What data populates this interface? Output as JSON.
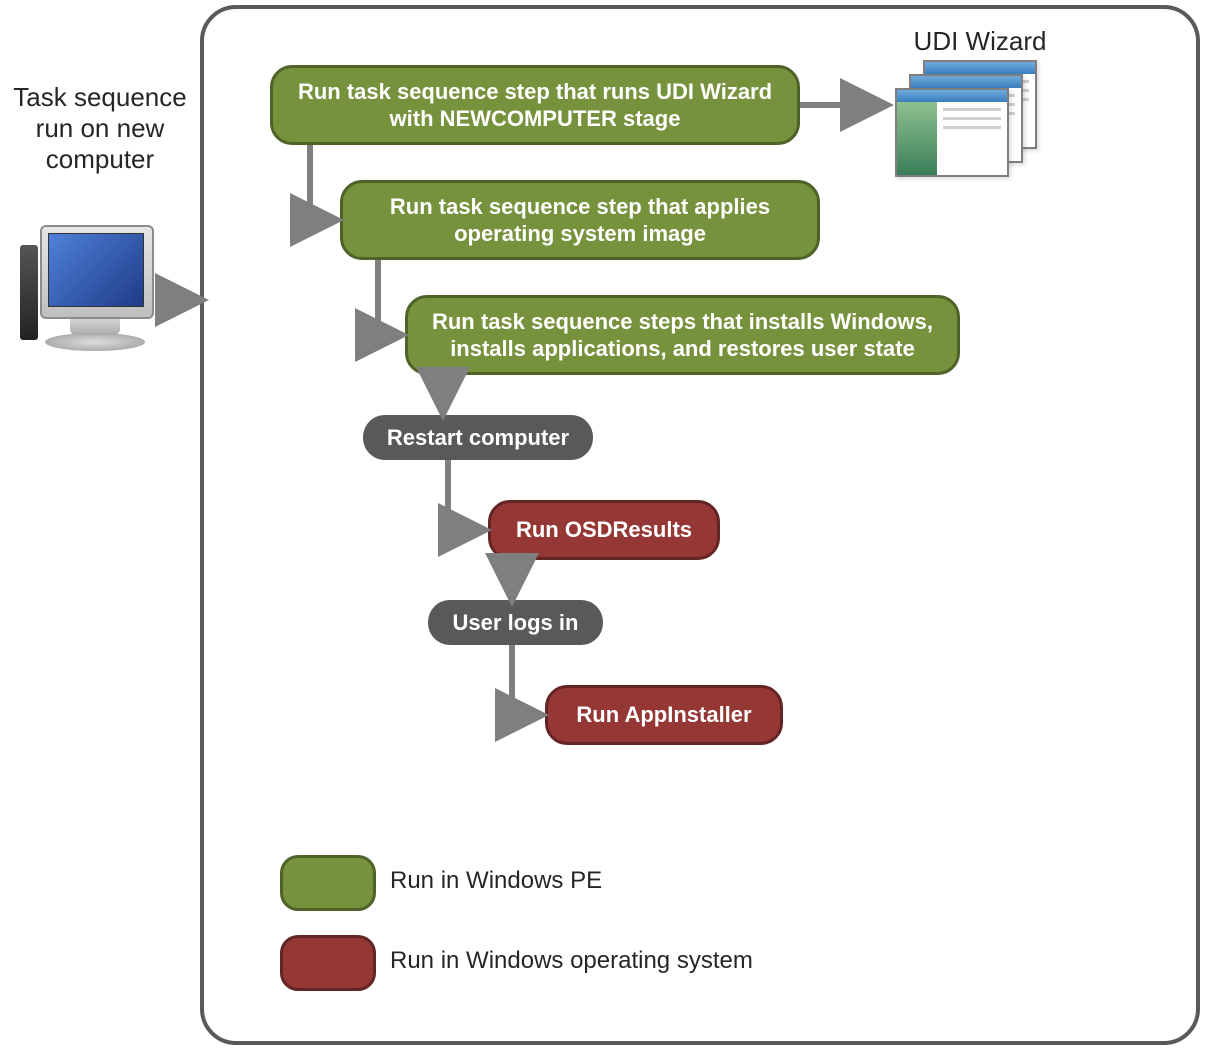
{
  "left_label": "Task sequence run on new computer",
  "udi_label": "UDI Wizard",
  "nodes": {
    "step1": "Run task sequence step  that runs UDI Wizard with NEWCOMPUTER  stage",
    "step2": "Run  task sequence step that applies operating system image",
    "step3": "Run task sequence steps that installs Windows, installs applications, and restores user state",
    "restart": "Restart computer",
    "osd": "Run OSDResults",
    "userlogs": "User logs in",
    "appinstaller": "Run AppInstaller"
  },
  "legend": {
    "pe": "Run in Windows  PE",
    "os": "Run in Windows operating system"
  },
  "colors": {
    "green_fill": "#76923C",
    "green_border": "#4F6228",
    "red_fill": "#953734",
    "red_border": "#632523",
    "gray": "#595959"
  }
}
